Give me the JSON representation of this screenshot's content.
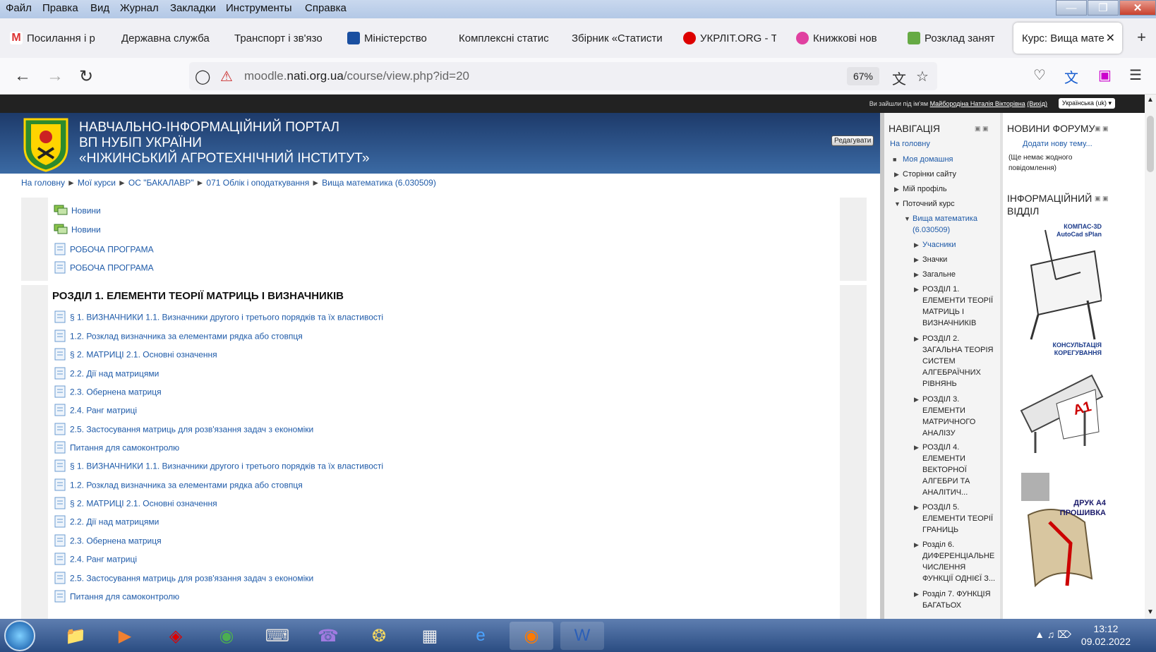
{
  "menu": [
    "Файл",
    "Правка",
    "Вид",
    "Журнал",
    "Закладки",
    "Инструменты",
    "Справка"
  ],
  "tabs": [
    {
      "label": "Посилання і р",
      "color": "#d33"
    },
    {
      "label": "Державна служба",
      "color": ""
    },
    {
      "label": "Транспорт і зв'язо",
      "color": ""
    },
    {
      "label": "Міністерство",
      "color": "#1a4fa0"
    },
    {
      "label": "Комплексні статис",
      "color": ""
    },
    {
      "label": "Збірник «Статисти",
      "color": ""
    },
    {
      "label": "УКРЛІТ.ORG - Т",
      "color": "#d00"
    },
    {
      "label": "Книжкові нов",
      "color": "#e040a0"
    },
    {
      "label": "Розклад занят",
      "color": "#6a4"
    },
    {
      "label": "Курс: Вища мате",
      "color": ""
    }
  ],
  "url": {
    "domain_pre": "moodle.",
    "domain": "nati.org.ua",
    "path": "/course/view.php?id=20",
    "zoom": "67%"
  },
  "site": {
    "login_prefix": "Ви зайшли під ім'ям",
    "login_name": "Майбородіна Наталія Вікторівна",
    "logout": "(Вихід)",
    "language": "Українська (uk)",
    "title1": "НАВЧАЛЬНО-ІНФОРМАЦІЙНИЙ ПОРТАЛ",
    "title2": "ВП НУБІП УКРАЇНИ",
    "title3": "«НІЖИНСЬКИЙ АГРОТЕХНІЧНИЙ ІНСТИТУТ»",
    "edit": "Редагувати"
  },
  "breadcrumb": [
    "На головну",
    "Мої курси",
    "ОС \"БАКАЛАВР\"",
    "071 Облік і оподаткування",
    "Вища математика (6.030509)"
  ],
  "top_items": [
    {
      "label": "Новини",
      "type": "forum"
    },
    {
      "label": "Новини",
      "type": "forum"
    },
    {
      "label": "РОБОЧА ПРОГРАМА",
      "type": "file"
    },
    {
      "label": "РОБОЧА ПРОГРАМА",
      "type": "file"
    }
  ],
  "section1": {
    "title": "РОЗДІЛ 1. ЕЛЕМЕНТИ ТЕОРІЇ МАТРИЦЬ І ВИЗНАЧНИКІВ",
    "items": [
      "§ 1. ВИЗНАЧНИКИ 1.1. Визначники другого і третього порядків та їх властивості",
      "1.2. Розклад визначника за елементами рядка або стовпця",
      "§ 2. МАТРИЦІ 2.1. Основні означення",
      "2.2. Дії над матрицями",
      "2.3. Обернена матриця",
      "2.4. Ранг матриці",
      "2.5. Застосування матриць для розв'язання задач з економіки",
      "Питання для самоконтролю",
      "§ 1. ВИЗНАЧНИКИ 1.1. Визначники другого і третього порядків та їх властивості",
      "1.2. Розклад визначника за елементами рядка або стовпця",
      "§ 2. МАТРИЦІ 2.1. Основні означення",
      "2.2. Дії над матрицями",
      "2.3. Обернена матриця",
      "2.4. Ранг матриці",
      "2.5. Застосування матриць для розв'язання задач з економіки",
      "Питання для самоконтролю"
    ]
  },
  "navigation": {
    "title": "НАВІГАЦІЯ",
    "home": "На головну",
    "my_home": "Моя домашня",
    "site_pages": "Сторінки сайту",
    "my_profile": "Мій профіль",
    "current_course": "Поточний курс",
    "course": "Вища математика (6.030509)",
    "participants": "Учасники",
    "badges": "Значки",
    "general": "Загальне",
    "sections": [
      "РОЗДІЛ 1. ЕЛЕМЕНТИ ТЕОРІЇ МАТРИЦЬ І ВИЗНАЧНИКІВ",
      "РОЗДІЛ 2. ЗАГАЛЬНА ТЕОРІЯ СИСТЕМ АЛГЕБРАЇЧНИХ РІВНЯНЬ",
      "РОЗДІЛ 3. ЕЛЕМЕНТИ МАТРИЧНОГО АНАЛІЗУ",
      "РОЗДІЛ 4. ЕЛЕМЕНТИ ВЕКТОРНОЇ АЛГЕБРИ ТА АНАЛІТИЧ...",
      "РОЗДІЛ 5. ЕЛЕМЕНТИ ТЕОРІЇ ГРАНИЦЬ",
      "Розділ 6. ДИФЕРЕНЦІАЛЬНЕ ЧИСЛЕННЯ ФУНКЦІЇ ОДНІЄЇ З...",
      "Розділ 7. ФУНКЦІЯ БАГАТЬОХ"
    ]
  },
  "forum": {
    "title": "НОВИНИ ФОРУМУ",
    "add": "Додати нову тему...",
    "empty": "(Ще немає жодного повідомлення)"
  },
  "info": {
    "title": "ІНФОРМАЦІЙНИЙ ВІДДІЛ",
    "ad1_top": "КОМПАС-3D AutoCad sPlan",
    "ad1_bottom": "КОНСУЛЬТАЦІЯ КОРЕГУВАННЯ",
    "ad2": "A1",
    "ad3": "ДРУК А4 ПРОШИВКА"
  },
  "taskbar": {
    "time": "13:12",
    "date": "09.02.2022"
  }
}
